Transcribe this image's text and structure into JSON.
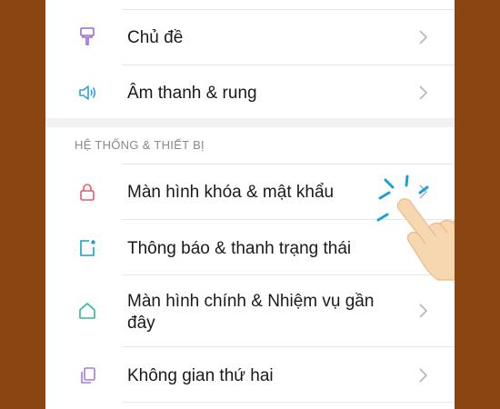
{
  "settings": {
    "rows_top": [
      {
        "label": "Chủ đề",
        "icon": "brush-icon"
      },
      {
        "label": "Âm thanh & rung",
        "icon": "speaker-icon"
      }
    ],
    "section_title": "HỆ THỐNG & THIẾT BỊ",
    "rows_system": [
      {
        "label": "Màn hình khóa & mật khẩu",
        "icon": "lock-icon"
      },
      {
        "label": "Thông báo & thanh trạng thái",
        "icon": "notification-icon"
      },
      {
        "label_line1": "Màn hình chính & Nhiệm vụ gần",
        "label_line2": "đây",
        "icon": "home-icon"
      },
      {
        "label": "Không gian thứ hai",
        "icon": "copy-icon"
      }
    ]
  },
  "colors": {
    "background": "#8b4513",
    "brush": "#9a6ad8",
    "speaker": "#2f9fe0",
    "lock": "#e35a6e",
    "notification": "#1a9cd8",
    "home": "#2eb79a",
    "copy": "#a07de0",
    "hand_tap_lines": "#1da1d4",
    "hand_skin": "#f7d7b0"
  }
}
